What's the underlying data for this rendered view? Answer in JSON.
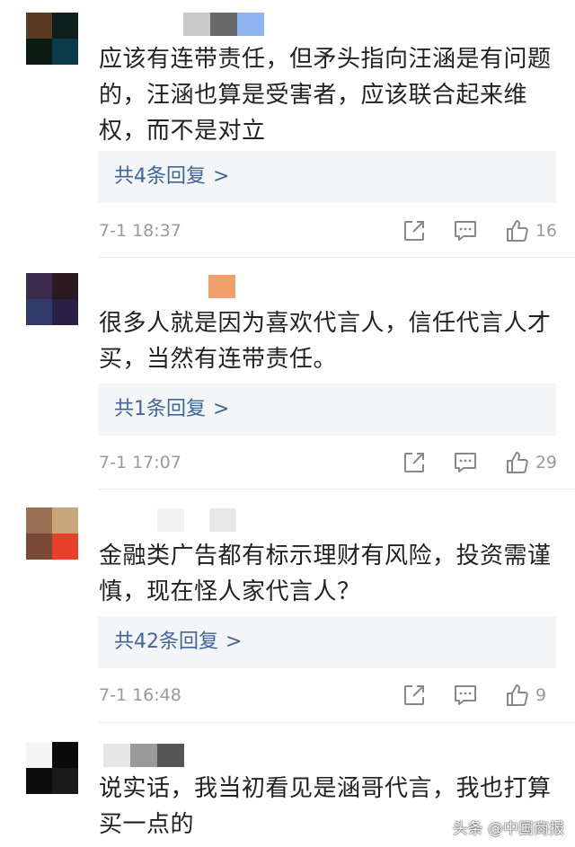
{
  "comments": [
    {
      "text_lines": [
        "应该有连带责任，但矛头指向汪涵是有问题",
        "的，汪涵也算是受害者，应该联合起来维",
        "权，而不是对立"
      ],
      "replies_label": "共4条回复",
      "chevron": ">",
      "time": "7-1 18:37",
      "likes": "16",
      "avatar_colors": [
        "#5b3a24",
        "#0f1f1c",
        "#0d1c12",
        "#0b3a4a"
      ],
      "name_blur_colors": [
        "#c9c9c9",
        "#6a6a6a",
        "#8fb2f0"
      ]
    },
    {
      "text_lines": [
        "很多人就是因为喜欢代言人，信任代言人才",
        "买，当然有连带责任。"
      ],
      "replies_label": "共1条回复",
      "chevron": ">",
      "time": "7-1 17:07",
      "likes": "29",
      "avatar_colors": [
        "#3c2a4a",
        "#2a1a20",
        "#323a6a",
        "#2a2046"
      ],
      "name_blur_colors": [
        "#f0a06a"
      ]
    },
    {
      "text_lines": [
        "金融类广告都有标示理财有风险，投资需谨",
        "慎，现在怪人家代言人？"
      ],
      "replies_label": "共42条回复",
      "chevron": ">",
      "time": "7-1 16:48",
      "likes": "9",
      "avatar_colors": [
        "#9a7055",
        "#c9a57a",
        "#7a4a38",
        "#e8402a"
      ],
      "name_blur_colors": [
        "#f2f2f2",
        "#e8e8e8"
      ]
    },
    {
      "text_lines": [
        "说实话，我当初看见是涵哥代言，我也打算",
        "买一点的"
      ],
      "avatar_colors": [
        "#0a0a0a",
        "#1a1a1a",
        "#0d0d0d",
        "#f5f5f5"
      ],
      "name_blur_colors": [
        "#e6e6e6",
        "#9a9a9a",
        "#555555"
      ]
    }
  ],
  "icons": {
    "share": "share-icon",
    "comment": "comment-icon",
    "like": "thumbs-up-icon"
  },
  "watermark": "头条 @中国商报"
}
